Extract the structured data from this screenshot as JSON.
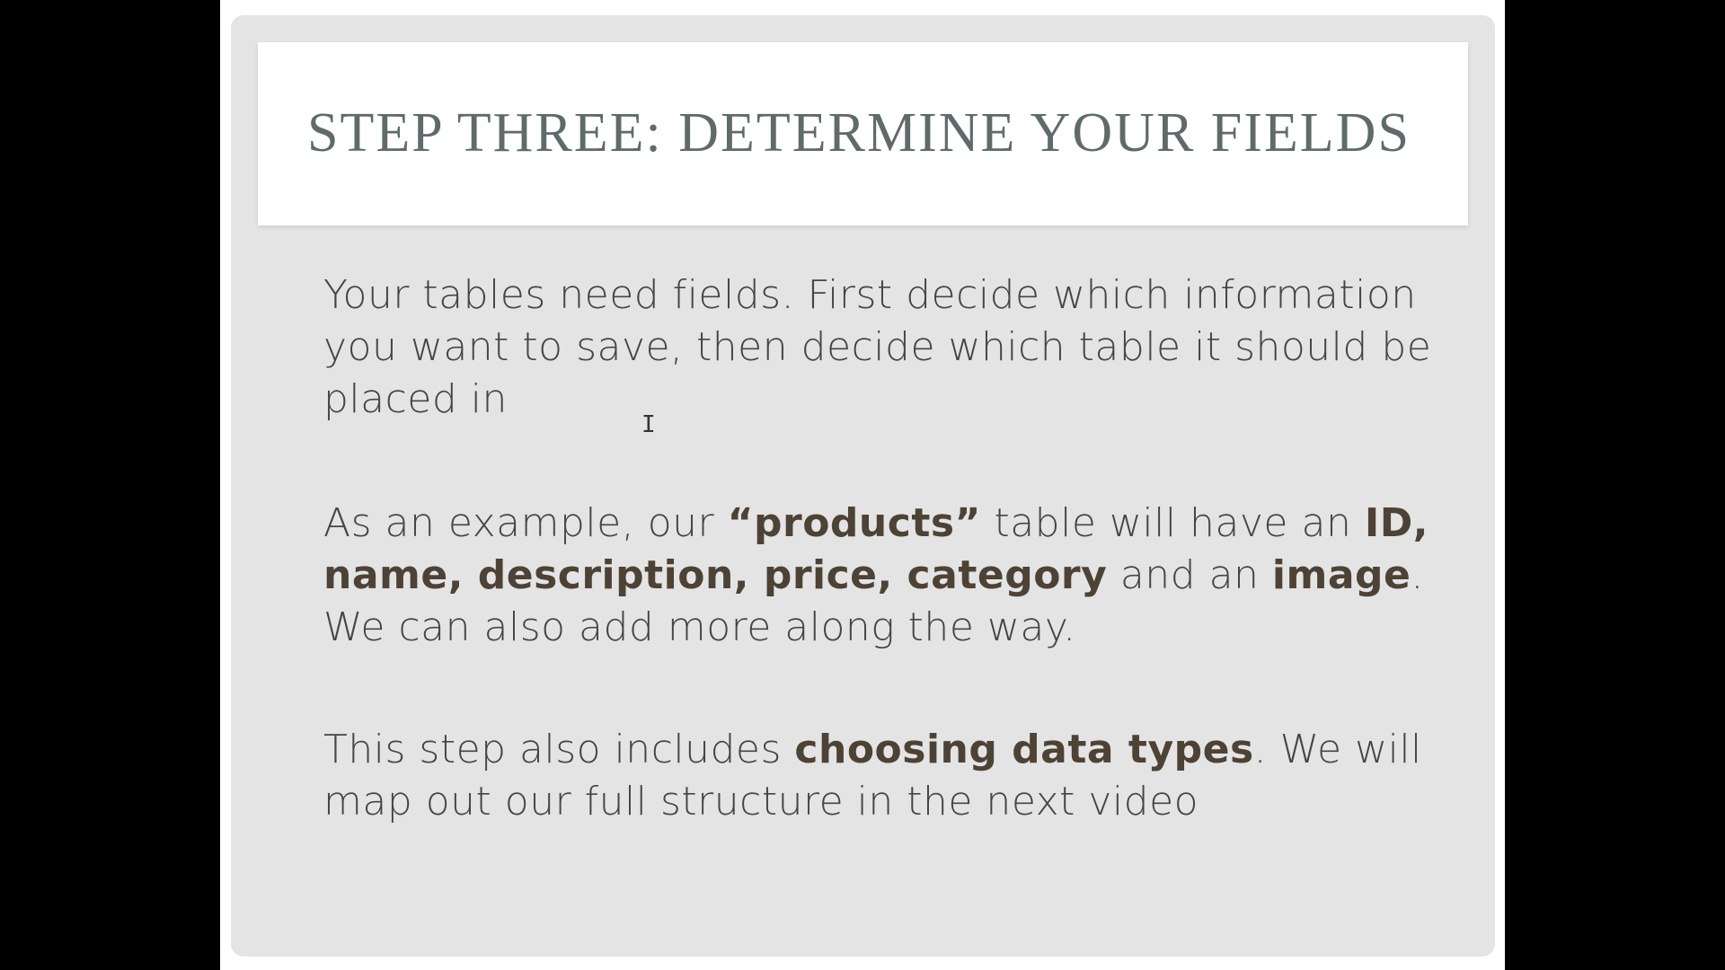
{
  "slide": {
    "title": "STEP THREE: DETERMINE YOUR FIELDS",
    "paragraph1": "Your tables need fields. First decide which information you want to save, then decide which table it should be placed in",
    "paragraph2": {
      "s1": "As an example, our ",
      "b1": "“products”",
      "s2": " table will have an ",
      "b2": "ID, name, description, price, category",
      "s3": " and an ",
      "b3": "image",
      "s4": ". We can also add more along the way."
    },
    "paragraph3": {
      "s1": "This step also includes ",
      "b1": "choosing data types",
      "s2": ". We will map out our full structure in the next video"
    }
  },
  "cursor": {
    "glyph": "I",
    "icon": "text-cursor-icon"
  },
  "colors": {
    "background": "#000000",
    "panel": "#e4e4e4",
    "title": "#5f6b69",
    "body": "#454545",
    "bold": "#4d4236"
  }
}
